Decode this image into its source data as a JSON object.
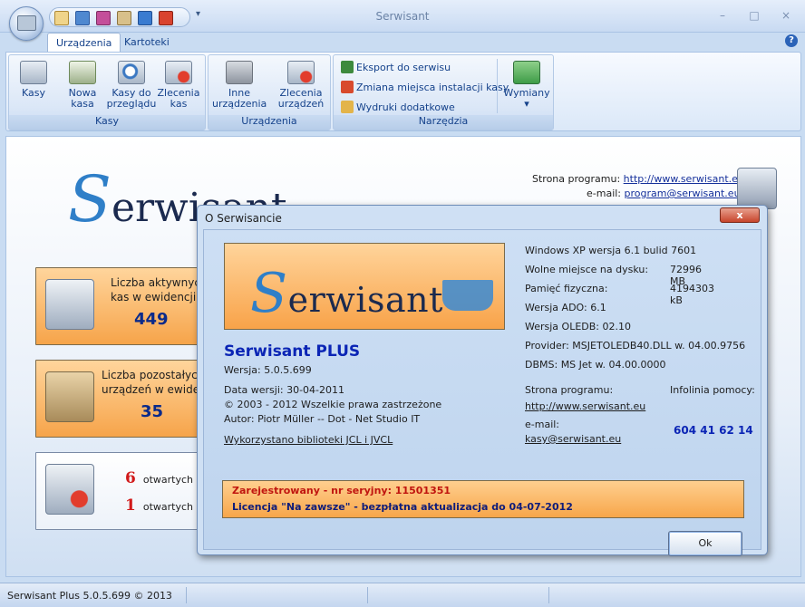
{
  "app": {
    "title": "Serwisant"
  },
  "window_controls": {
    "minimize": "–",
    "maximize": "□",
    "close": "×"
  },
  "tabs": [
    {
      "label": "Urządzenia"
    },
    {
      "label": "Kartoteki"
    }
  ],
  "ribbon": {
    "groups": [
      {
        "label": "Kasy"
      },
      {
        "label": "Urządzenia"
      },
      {
        "label": "Narzędzia"
      }
    ],
    "kasy_buttons": [
      {
        "label": "Kasy"
      },
      {
        "label": "Nowa kasa"
      },
      {
        "label": "Kasy do przeglądu"
      },
      {
        "label": "Zlecenia kas"
      }
    ],
    "urzadzenia_buttons": [
      {
        "label": "Inne urządzenia"
      },
      {
        "label": "Zlecenia urządzeń"
      }
    ],
    "tools": [
      {
        "label": "Eksport do serwisu"
      },
      {
        "label": "Zmiana miejsca instalacji kasy"
      },
      {
        "label": "Wydruki dodatkowe"
      }
    ],
    "wymiany": {
      "label": "Wymiany",
      "arrow": "▾"
    }
  },
  "main": {
    "logo_text": "erwisant",
    "logo_initial": "S",
    "site_label": "Strona programu:",
    "site_url": "http://www.serwisant.eu",
    "email_label": "e-mail:",
    "email": "program@serwisant.eu",
    "cards": [
      {
        "text_line1": "Liczba aktywnych",
        "text_line2": "kas w ewidencji:",
        "value": "449"
      },
      {
        "text_line1": "Liczba pozostałych",
        "text_line2": "urządzeń w ewiden",
        "value": "35"
      }
    ],
    "open_rows": [
      {
        "count": "6",
        "label": "otwartych"
      },
      {
        "count": "1",
        "label": "otwartych"
      }
    ]
  },
  "status": {
    "text": "Serwisant Plus 5.0.5.699 © 2013"
  },
  "dialog": {
    "title": "O Serwisancie",
    "close": "x",
    "product": "Serwisant PLUS",
    "version": "Wersja: 5.0.5.699",
    "date": "Data wersji: 30-04-2011",
    "copyright": "© 2003 - 2012 Wszelkie prawa zastrzeżone",
    "author": "Autor:  Piotr Müller --  Dot - Net Studio IT",
    "libs": "Wykorzystano biblioteki JCL i JVCL",
    "system": [
      {
        "label": "Windows XP wersja 6.1 bulid  7601",
        "value": ""
      },
      {
        "label": "Wolne miejsce na dysku:",
        "value": "72996 MB"
      },
      {
        "label": "Pamięć fizyczna:",
        "value": "4194303 kB"
      },
      {
        "label": "Wersja ADO: 6.1",
        "value": ""
      },
      {
        "label": "Wersja OLEDB: 02.10",
        "value": ""
      },
      {
        "label": "Provider: MSJETOLEDB40.DLL w. 04.00.9756",
        "value": ""
      },
      {
        "label": "DBMS: MS Jet w. 04.00.0000",
        "value": ""
      }
    ],
    "site_label": "Strona programu:",
    "site_url": "http://www.serwisant.eu",
    "helpline_label": "Infolinia pomocy:",
    "helpline": "604 41 62 14",
    "email_label": "e-mail:",
    "email": "kasy@serwisant.eu",
    "license_line1": "Zarejestrowany - nr seryjny: 11501351",
    "license_line2": "Licencja \"Na zawsze\" - bezpłatna aktualizacja do 04-07-2012",
    "ok": "Ok"
  },
  "colors": {
    "accent": "#15428b",
    "orange": "#f6a44a",
    "link": "#15309b",
    "red": "#c0150f"
  }
}
